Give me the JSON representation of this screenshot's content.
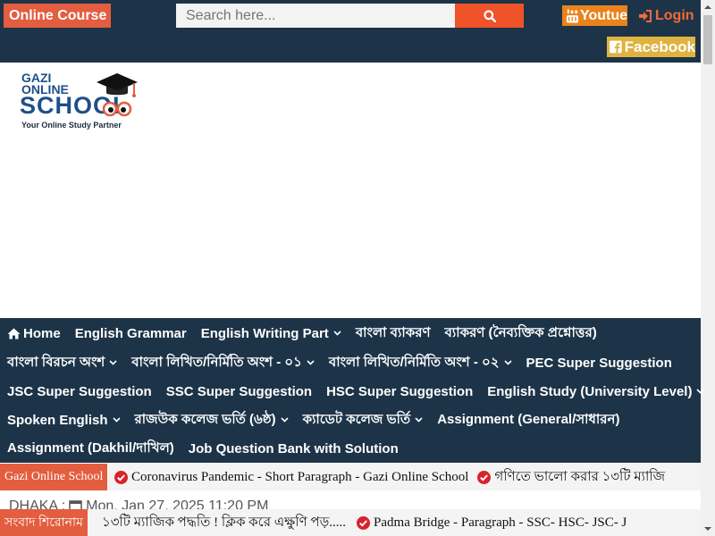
{
  "topbar": {
    "course_label": "Online Course",
    "search_placeholder": "Search here...",
    "youtube_label": "Youtue",
    "login_label": "Login",
    "facebook_label": "Facebook"
  },
  "logo": {
    "line1": "GAZI",
    "line2": "ONLINE",
    "line3": "SCHOOL",
    "tagline": "Your Online Study Partner"
  },
  "nav": {
    "rows": [
      [
        {
          "label": "Home",
          "icon": "home-icon",
          "dropdown": false
        },
        {
          "label": "English Grammar",
          "dropdown": false
        },
        {
          "label": "English Writing Part",
          "dropdown": true
        },
        {
          "label": "বাংলা ব্যাকরণ",
          "dropdown": false
        },
        {
          "label": "ব্যাকরণ (নৈব্যক্তিক প্রশ্নোত্তর)",
          "dropdown": false
        }
      ],
      [
        {
          "label": "বাংলা বিরচন অংশ",
          "dropdown": true
        },
        {
          "label": "বাংলা লিখিত/নির্মিতি অংশ - ০১",
          "dropdown": true
        },
        {
          "label": "বাংলা লিখিত/নির্মিতি অংশ - ০২",
          "dropdown": true
        },
        {
          "label": "PEC Super Suggestion",
          "dropdown": false
        }
      ],
      [
        {
          "label": "JSC Super Suggestion",
          "dropdown": false
        },
        {
          "label": "SSC Super Suggestion",
          "dropdown": false
        },
        {
          "label": "HSC Super Suggestion",
          "dropdown": false
        },
        {
          "label": "English Study (University Level)",
          "dropdown": true
        }
      ],
      [
        {
          "label": "Spoken English",
          "dropdown": true
        },
        {
          "label": "রাজউক কলেজ ভর্তি (৬ষ্ঠ)",
          "dropdown": true
        },
        {
          "label": "ক্যাডেট কলেজ ভর্তি",
          "dropdown": true
        },
        {
          "label": "Assignment (General/সাধারন)",
          "dropdown": false
        }
      ],
      [
        {
          "label": "Assignment (Dakhil/দাখিল)",
          "dropdown": false
        },
        {
          "label": "Job Question Bank with Solution",
          "dropdown": false
        }
      ]
    ]
  },
  "ticker1": {
    "label": "Gazi Online School",
    "items": [
      "Coronavirus Pandemic - Short Paragraph - Gazi Online School",
      "গণিতে ভালো করার ১৩টি ম্যাজি"
    ]
  },
  "date_line": {
    "city": "DHAKA :",
    "datetime": "Mon, Jan 27, 2025 11:20 PM"
  },
  "ticker2": {
    "label": "সংবাদ শিরোনাম",
    "items": [
      "১৩টি ম্যাজিক পদ্ধতি ! ক্লিক করে এক্ষুণি পড়.....",
      "Padma Bridge - Paragraph - SSC- HSC- JSC- J"
    ]
  },
  "colors": {
    "navy": "#1d3448",
    "accent": "#e35d3f",
    "search_button": "#f0522a",
    "youtube": "#e8831d",
    "facebook": "#e0b340",
    "check_red": "#d8232a"
  }
}
